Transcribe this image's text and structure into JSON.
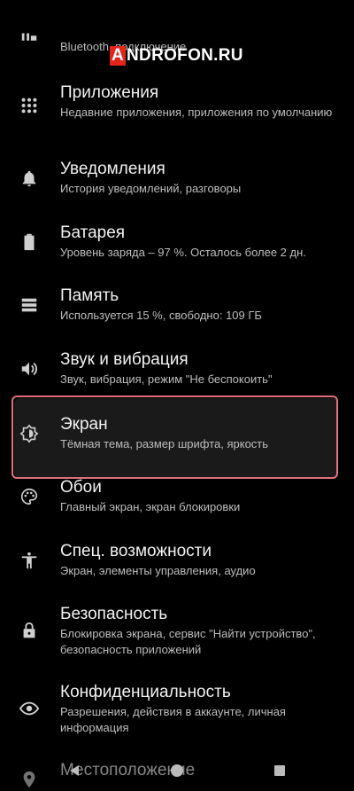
{
  "watermark": {
    "first_letter": "A",
    "rest": "NDROFON.RU"
  },
  "items": [
    {
      "title": "",
      "subtitle": "Bluetooth, подключение",
      "icon": "connected-devices-icon"
    },
    {
      "title": "Приложения",
      "subtitle": "Недавние приложения, приложения по умолчанию",
      "icon": "apps-grid-icon"
    },
    {
      "title": "Уведомления",
      "subtitle": "История уведомлений, разговоры",
      "icon": "bell-icon"
    },
    {
      "title": "Батарея",
      "subtitle": "Уровень заряда – 97 %. Осталось более 2 дн.",
      "icon": "battery-icon"
    },
    {
      "title": "Память",
      "subtitle": "Используется 15 %, свободно: 109 ГБ",
      "icon": "storage-icon"
    },
    {
      "title": "Звук и вибрация",
      "subtitle": "Звук, вибрация, режим \"Не беспокоить\"",
      "icon": "volume-icon"
    },
    {
      "title": "Экран",
      "subtitle": "Тёмная тема, размер шрифта, яркость",
      "icon": "brightness-icon"
    },
    {
      "title": "Обои",
      "subtitle": "Главный экран, экран блокировки",
      "icon": "palette-icon"
    },
    {
      "title": "Спец. возможности",
      "subtitle": "Экран, элементы управления, аудио",
      "icon": "accessibility-icon"
    },
    {
      "title": "Безопасность",
      "subtitle": "Блокировка экрана, сервис \"Найти устройство\", безопасность приложений",
      "icon": "lock-icon"
    },
    {
      "title": "Конфиденциальность",
      "subtitle": "Разрешения, действия в аккаунте, личная информация",
      "icon": "privacy-eye-icon"
    },
    {
      "title": "Местоположение",
      "subtitle": "",
      "icon": "location-pin-icon"
    }
  ],
  "colors": {
    "highlight": "#e0707a",
    "background": "#000000"
  }
}
